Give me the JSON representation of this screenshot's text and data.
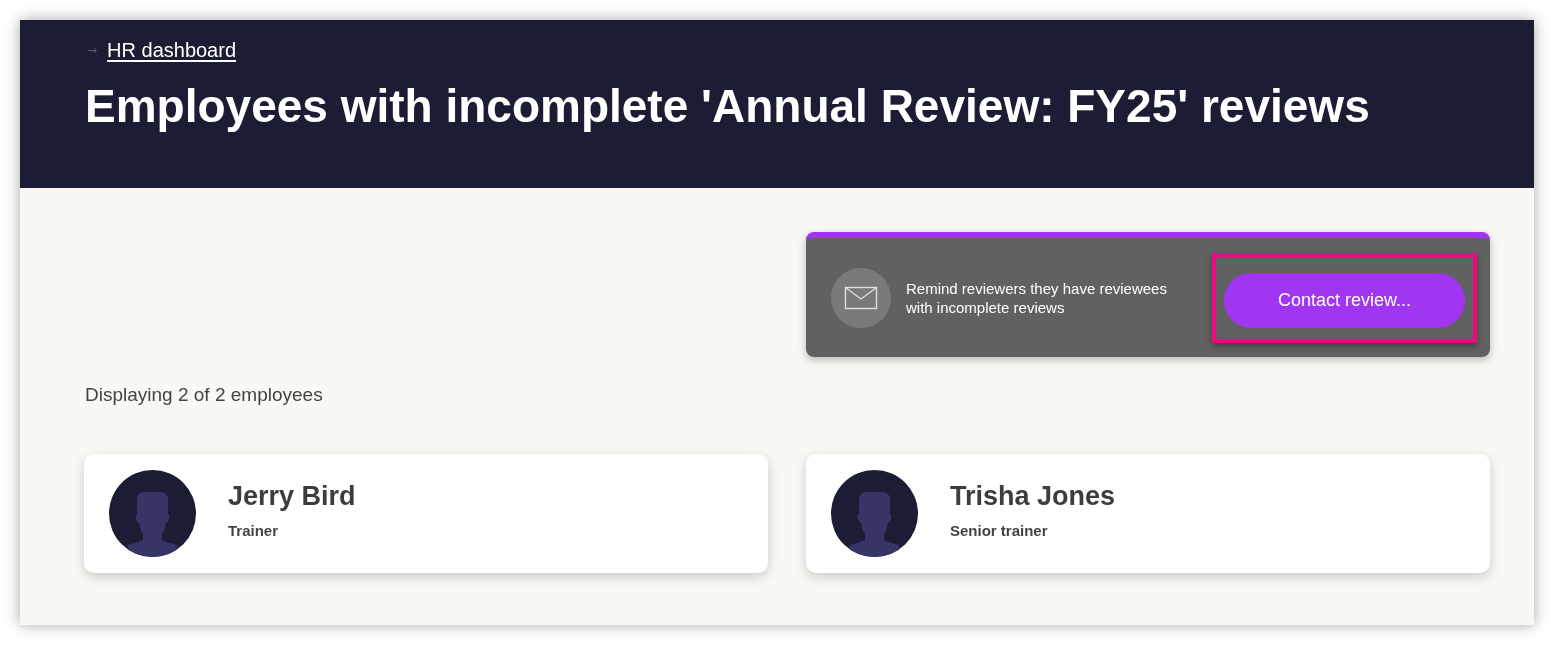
{
  "breadcrumb": {
    "arrow": "→",
    "link": "HR dashboard"
  },
  "title": "Employees with incomplete 'Annual Review: FY25' reviews",
  "reminder": {
    "message": "Remind reviewers they have reviewees with incomplete reviews",
    "button": {
      "label": "Contact review...",
      "highlighted": true
    }
  },
  "summary": "Displaying 2 of 2 employees",
  "employees": [
    {
      "name": "Jerry Bird",
      "role": "Trainer"
    },
    {
      "name": "Trisha Jones",
      "role": "Senior trainer"
    }
  ]
}
